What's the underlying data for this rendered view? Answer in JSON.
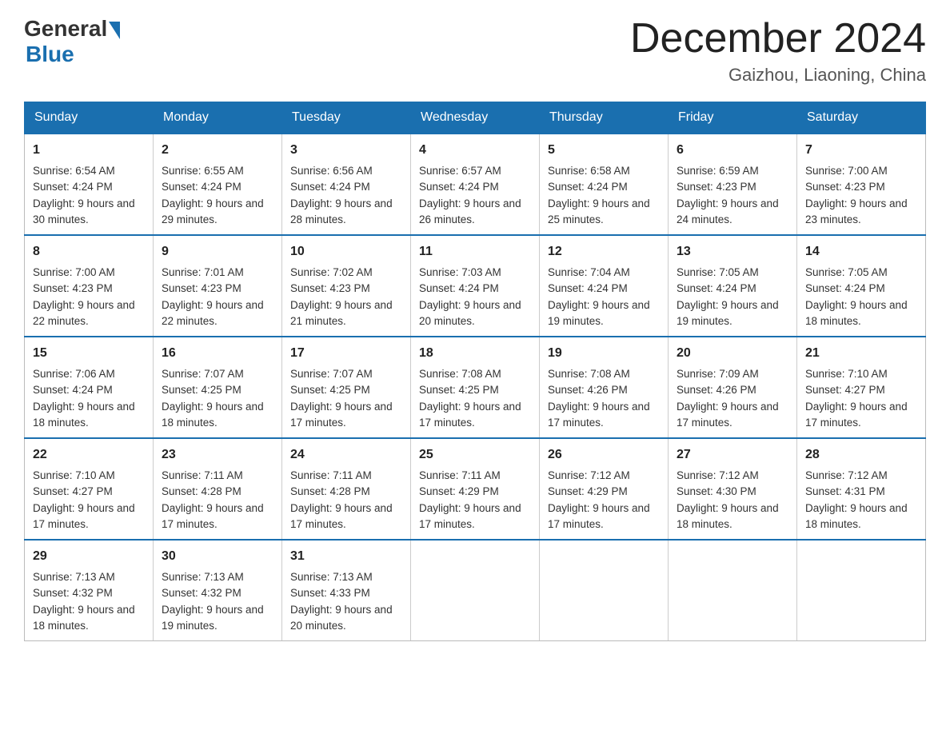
{
  "header": {
    "logo_general": "General",
    "logo_blue": "Blue",
    "month_title": "December 2024",
    "location": "Gaizhou, Liaoning, China"
  },
  "days_of_week": [
    "Sunday",
    "Monday",
    "Tuesday",
    "Wednesday",
    "Thursday",
    "Friday",
    "Saturday"
  ],
  "weeks": [
    [
      {
        "day": "1",
        "sunrise": "6:54 AM",
        "sunset": "4:24 PM",
        "daylight": "9 hours and 30 minutes."
      },
      {
        "day": "2",
        "sunrise": "6:55 AM",
        "sunset": "4:24 PM",
        "daylight": "9 hours and 29 minutes."
      },
      {
        "day": "3",
        "sunrise": "6:56 AM",
        "sunset": "4:24 PM",
        "daylight": "9 hours and 28 minutes."
      },
      {
        "day": "4",
        "sunrise": "6:57 AM",
        "sunset": "4:24 PM",
        "daylight": "9 hours and 26 minutes."
      },
      {
        "day": "5",
        "sunrise": "6:58 AM",
        "sunset": "4:24 PM",
        "daylight": "9 hours and 25 minutes."
      },
      {
        "day": "6",
        "sunrise": "6:59 AM",
        "sunset": "4:23 PM",
        "daylight": "9 hours and 24 minutes."
      },
      {
        "day": "7",
        "sunrise": "7:00 AM",
        "sunset": "4:23 PM",
        "daylight": "9 hours and 23 minutes."
      }
    ],
    [
      {
        "day": "8",
        "sunrise": "7:00 AM",
        "sunset": "4:23 PM",
        "daylight": "9 hours and 22 minutes."
      },
      {
        "day": "9",
        "sunrise": "7:01 AM",
        "sunset": "4:23 PM",
        "daylight": "9 hours and 22 minutes."
      },
      {
        "day": "10",
        "sunrise": "7:02 AM",
        "sunset": "4:23 PM",
        "daylight": "9 hours and 21 minutes."
      },
      {
        "day": "11",
        "sunrise": "7:03 AM",
        "sunset": "4:24 PM",
        "daylight": "9 hours and 20 minutes."
      },
      {
        "day": "12",
        "sunrise": "7:04 AM",
        "sunset": "4:24 PM",
        "daylight": "9 hours and 19 minutes."
      },
      {
        "day": "13",
        "sunrise": "7:05 AM",
        "sunset": "4:24 PM",
        "daylight": "9 hours and 19 minutes."
      },
      {
        "day": "14",
        "sunrise": "7:05 AM",
        "sunset": "4:24 PM",
        "daylight": "9 hours and 18 minutes."
      }
    ],
    [
      {
        "day": "15",
        "sunrise": "7:06 AM",
        "sunset": "4:24 PM",
        "daylight": "9 hours and 18 minutes."
      },
      {
        "day": "16",
        "sunrise": "7:07 AM",
        "sunset": "4:25 PM",
        "daylight": "9 hours and 18 minutes."
      },
      {
        "day": "17",
        "sunrise": "7:07 AM",
        "sunset": "4:25 PM",
        "daylight": "9 hours and 17 minutes."
      },
      {
        "day": "18",
        "sunrise": "7:08 AM",
        "sunset": "4:25 PM",
        "daylight": "9 hours and 17 minutes."
      },
      {
        "day": "19",
        "sunrise": "7:08 AM",
        "sunset": "4:26 PM",
        "daylight": "9 hours and 17 minutes."
      },
      {
        "day": "20",
        "sunrise": "7:09 AM",
        "sunset": "4:26 PM",
        "daylight": "9 hours and 17 minutes."
      },
      {
        "day": "21",
        "sunrise": "7:10 AM",
        "sunset": "4:27 PM",
        "daylight": "9 hours and 17 minutes."
      }
    ],
    [
      {
        "day": "22",
        "sunrise": "7:10 AM",
        "sunset": "4:27 PM",
        "daylight": "9 hours and 17 minutes."
      },
      {
        "day": "23",
        "sunrise": "7:11 AM",
        "sunset": "4:28 PM",
        "daylight": "9 hours and 17 minutes."
      },
      {
        "day": "24",
        "sunrise": "7:11 AM",
        "sunset": "4:28 PM",
        "daylight": "9 hours and 17 minutes."
      },
      {
        "day": "25",
        "sunrise": "7:11 AM",
        "sunset": "4:29 PM",
        "daylight": "9 hours and 17 minutes."
      },
      {
        "day": "26",
        "sunrise": "7:12 AM",
        "sunset": "4:29 PM",
        "daylight": "9 hours and 17 minutes."
      },
      {
        "day": "27",
        "sunrise": "7:12 AM",
        "sunset": "4:30 PM",
        "daylight": "9 hours and 18 minutes."
      },
      {
        "day": "28",
        "sunrise": "7:12 AM",
        "sunset": "4:31 PM",
        "daylight": "9 hours and 18 minutes."
      }
    ],
    [
      {
        "day": "29",
        "sunrise": "7:13 AM",
        "sunset": "4:32 PM",
        "daylight": "9 hours and 18 minutes."
      },
      {
        "day": "30",
        "sunrise": "7:13 AM",
        "sunset": "4:32 PM",
        "daylight": "9 hours and 19 minutes."
      },
      {
        "day": "31",
        "sunrise": "7:13 AM",
        "sunset": "4:33 PM",
        "daylight": "9 hours and 20 minutes."
      },
      null,
      null,
      null,
      null
    ]
  ]
}
